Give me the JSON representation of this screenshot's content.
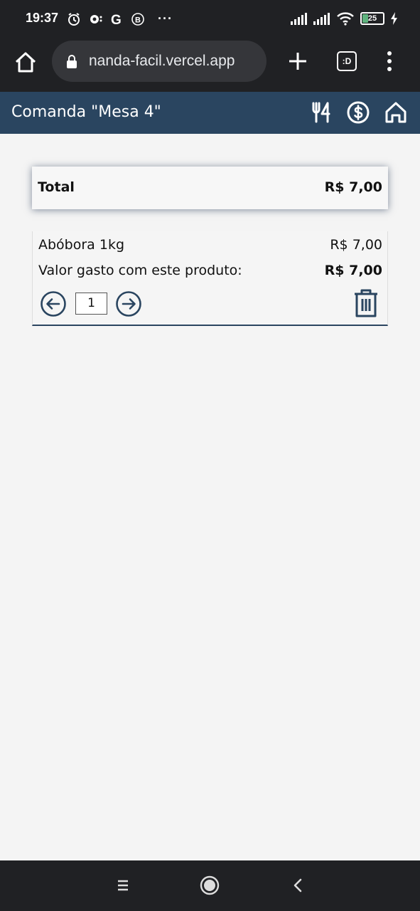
{
  "status_bar": {
    "time": "19:37",
    "battery": "25",
    "more": "···"
  },
  "browser": {
    "url": "nanda-facil.vercel.app",
    "tab_count": ":D"
  },
  "header": {
    "title": "Comanda \"Mesa 4\"",
    "icons": [
      "utensils-icon",
      "dollar-icon",
      "home-icon"
    ]
  },
  "total": {
    "label": "Total",
    "value": "R$ 7,00"
  },
  "items": [
    {
      "name": "Abóbora 1kg",
      "price": "R$ 7,00",
      "spent_label": "Valor gasto com este produto:",
      "spent_value": "R$ 7,00",
      "quantity": "1"
    }
  ],
  "colors": {
    "header_bg": "#2a4560",
    "system_bar": "#202124",
    "page_bg": "#f4f4f4"
  }
}
